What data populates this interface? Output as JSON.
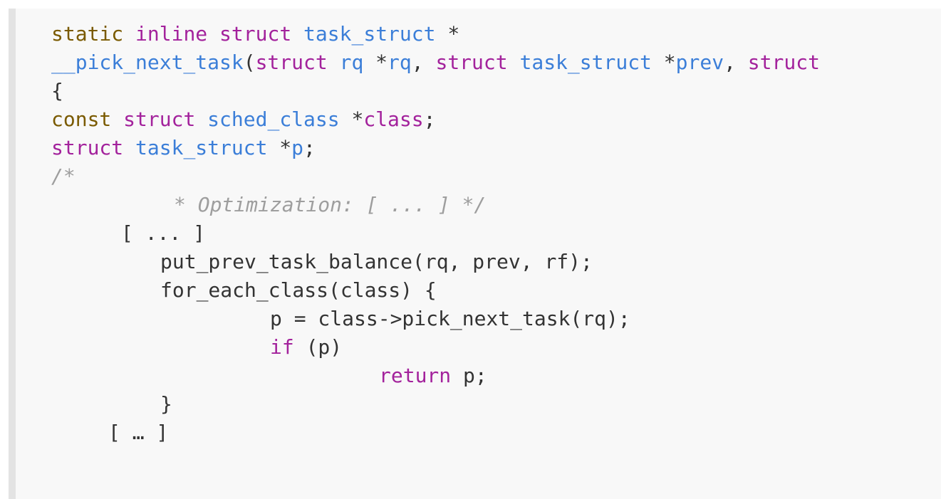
{
  "colors": {
    "background": "#f8f8f8",
    "left_bar": "#e3e3e3",
    "storage_keyword": "#7a5a00",
    "keyword": "#a3229c",
    "type_name": "#3b7ed8",
    "comment": "#9e9e9e",
    "plain": "#333333"
  },
  "code": {
    "lines": [
      [
        {
          "t": "static",
          "c": "kw-type"
        },
        {
          "t": " ",
          "c": "pl"
        },
        {
          "t": "inline",
          "c": "kw"
        },
        {
          "t": " ",
          "c": "pl"
        },
        {
          "t": "struct",
          "c": "kw"
        },
        {
          "t": " ",
          "c": "pl"
        },
        {
          "t": "task_struct",
          "c": "tp"
        },
        {
          "t": " *",
          "c": "pl"
        }
      ],
      [
        {
          "t": "__pick_next_task",
          "c": "tp"
        },
        {
          "t": "(",
          "c": "pl"
        },
        {
          "t": "struct",
          "c": "kw"
        },
        {
          "t": " ",
          "c": "pl"
        },
        {
          "t": "rq",
          "c": "tp"
        },
        {
          "t": " *",
          "c": "pl"
        },
        {
          "t": "rq",
          "c": "tp"
        },
        {
          "t": ", ",
          "c": "pl"
        },
        {
          "t": "struct",
          "c": "kw"
        },
        {
          "t": " ",
          "c": "pl"
        },
        {
          "t": "task_struct",
          "c": "tp"
        },
        {
          "t": " *",
          "c": "pl"
        },
        {
          "t": "prev",
          "c": "tp"
        },
        {
          "t": ", ",
          "c": "pl"
        },
        {
          "t": "struct",
          "c": "kw"
        }
      ],
      [
        {
          "t": "{",
          "c": "pl"
        }
      ],
      [
        {
          "t": "const",
          "c": "kw-type"
        },
        {
          "t": " ",
          "c": "pl"
        },
        {
          "t": "struct",
          "c": "kw"
        },
        {
          "t": " ",
          "c": "pl"
        },
        {
          "t": "sched_class",
          "c": "tp"
        },
        {
          "t": " *",
          "c": "pl"
        },
        {
          "t": "class",
          "c": "kw"
        },
        {
          "t": ";",
          "c": "pl"
        }
      ],
      [
        {
          "t": "struct",
          "c": "kw"
        },
        {
          "t": " ",
          "c": "pl"
        },
        {
          "t": "task_struct",
          "c": "tp"
        },
        {
          "t": " *",
          "c": "pl"
        },
        {
          "t": "p",
          "c": "tp"
        },
        {
          "t": ";",
          "c": "pl"
        }
      ],
      [
        {
          "t": "/*",
          "c": "cm"
        }
      ],
      [
        {
          "t": "* Optimization: [ ... ] */",
          "c": "cm"
        }
      ],
      [
        {
          "t": "[ ... ]",
          "c": "pl"
        }
      ],
      [
        {
          "t": "put_prev_task_balance(rq, prev, rf);",
          "c": "pl"
        }
      ],
      [
        {
          "t": "for_each_class(class) {",
          "c": "pl"
        }
      ],
      [
        {
          "t": "p = class->pick_next_task(rq);",
          "c": "pl"
        }
      ],
      [
        {
          "t": "if",
          "c": "kw"
        },
        {
          "t": " (p)",
          "c": "pl"
        }
      ],
      [
        {
          "t": "return",
          "c": "kw"
        },
        {
          "t": " p;",
          "c": "pl"
        }
      ],
      [
        {
          "t": "}",
          "c": "pl"
        }
      ],
      [
        {
          "t": "[ … ]",
          "c": "pl"
        }
      ]
    ]
  }
}
